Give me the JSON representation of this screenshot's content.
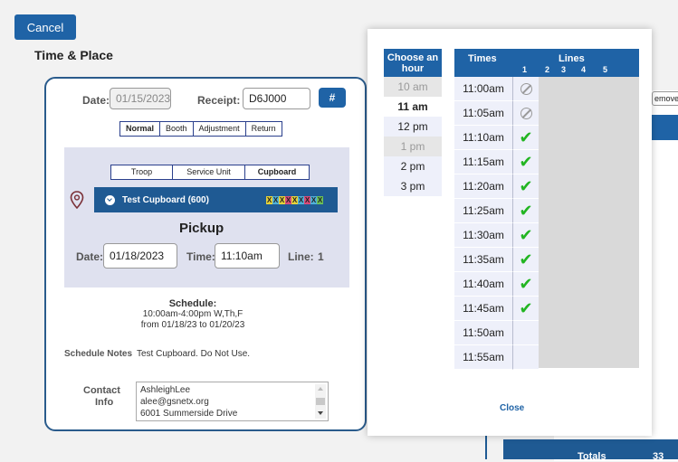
{
  "page": {
    "cancel_label": "Cancel",
    "section_title": "Time & Place"
  },
  "order": {
    "date_label": "Date:",
    "date_value": "01/15/2023",
    "receipt_label": "Receipt:",
    "receipt_value": "D6J000",
    "hash_label": "#",
    "types": [
      "Normal",
      "Booth",
      "Adjustment",
      "Return"
    ],
    "selected_type": "Normal"
  },
  "location": {
    "tabs": [
      "Troop",
      "Service Unit",
      "Cupboard"
    ],
    "selected_tab": "Cupboard",
    "cupboard_name": "Test Cupboard (600)",
    "cupboard_code": "XXXXXXXXX",
    "pickup_title": "Pickup",
    "pickup_date_label": "Date:",
    "pickup_date_value": "01/18/2023",
    "pickup_time_label": "Time:",
    "pickup_time_value": "11:10am",
    "line_label": "Line:",
    "line_value": "1"
  },
  "schedule": {
    "title": "Schedule:",
    "hours": "10:00am-4:00pm W,Th,F",
    "range": "from 01/18/23 to 01/20/23",
    "notes_label": "Schedule Notes",
    "notes_value": "Test Cupboard. Do Not Use."
  },
  "contact": {
    "label_line1": "Contact",
    "label_line2": "Info",
    "line1": "AshleighLee",
    "line2": "alee@gsnetx.org",
    "line3": "6001 Summerside Drive"
  },
  "background_right": {
    "remove_partial": "emove",
    "totals_label": "Totals",
    "totals_value": "33"
  },
  "picker": {
    "hour_header": "Choose an hour",
    "hours": [
      {
        "label": "10 am",
        "state": "disabled"
      },
      {
        "label": "11 am",
        "state": "active"
      },
      {
        "label": "12 pm",
        "state": "normal"
      },
      {
        "label": "1 pm",
        "state": "disabled"
      },
      {
        "label": "2 pm",
        "state": "normal"
      },
      {
        "label": "3 pm",
        "state": "normal"
      }
    ],
    "times_header": "Times",
    "lines_header": "Lines",
    "line_numbers": [
      "1",
      "2",
      "3",
      "4",
      "5"
    ],
    "times": [
      {
        "time": "11:00am",
        "line1": "unavailable"
      },
      {
        "time": "11:05am",
        "line1": "unavailable"
      },
      {
        "time": "11:10am",
        "line1": "available"
      },
      {
        "time": "11:15am",
        "line1": "available"
      },
      {
        "time": "11:20am",
        "line1": "available"
      },
      {
        "time": "11:25am",
        "line1": "available"
      },
      {
        "time": "11:30am",
        "line1": "available"
      },
      {
        "time": "11:35am",
        "line1": "available"
      },
      {
        "time": "11:40am",
        "line1": "available"
      },
      {
        "time": "11:45am",
        "line1": "available"
      },
      {
        "time": "11:50am",
        "line1": "empty"
      },
      {
        "time": "11:55am",
        "line1": "empty"
      }
    ],
    "close_label": "Close"
  },
  "colors": {
    "primary": "#1f63a6",
    "available": "#22b522",
    "panel": "#dfe1ef"
  },
  "code_colors": [
    "#e5d23a",
    "#4fb0d8",
    "#e5d23a",
    "#d94b7a",
    "#e5d23a",
    "#4fb0d8",
    "#d94b7a",
    "#4fb0d8",
    "#6bbf59"
  ]
}
